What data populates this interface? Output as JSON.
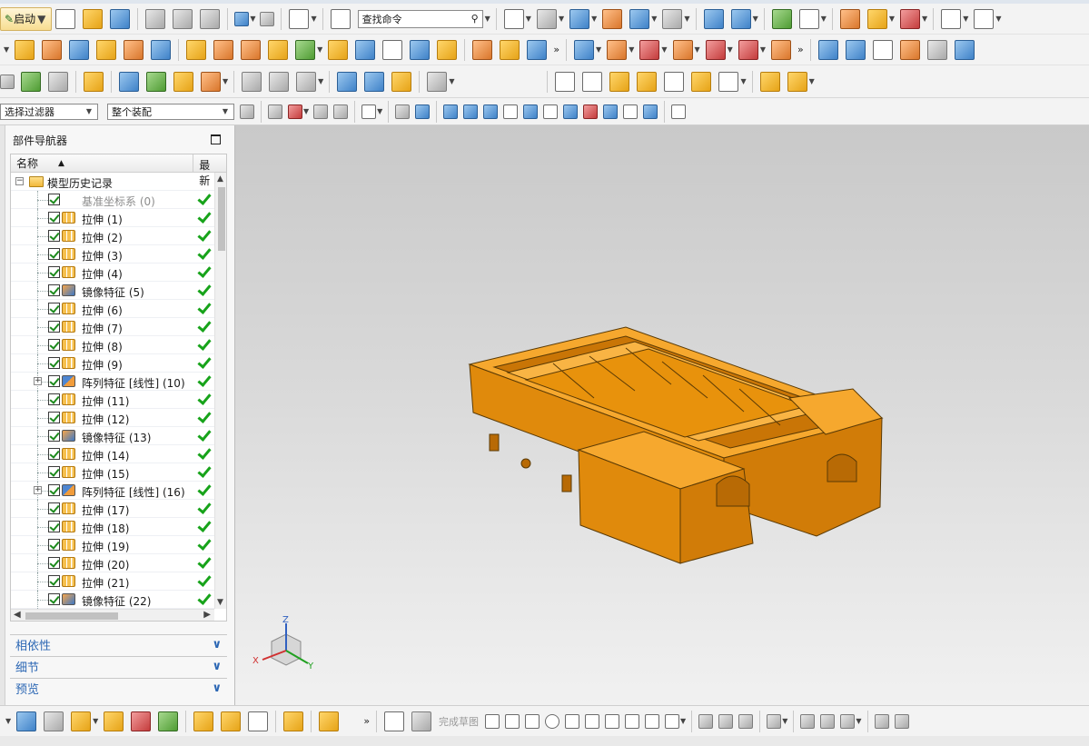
{
  "toolbar": {
    "start_label": "启动",
    "command_search_placeholder": "查找命令",
    "selection_filter": "选择过滤器",
    "selection_scope": "整个装配"
  },
  "navigator": {
    "title": "部件导航器",
    "col_name": "名称",
    "col_latest": "最新",
    "root_label": "模型历史记录",
    "features": [
      {
        "label": "基准坐标系 (0)",
        "type": "datum",
        "expand": false,
        "dim": true
      },
      {
        "label": "拉伸 (1)",
        "type": "ext",
        "expand": false
      },
      {
        "label": "拉伸 (2)",
        "type": "ext",
        "expand": false
      },
      {
        "label": "拉伸 (3)",
        "type": "ext",
        "expand": false
      },
      {
        "label": "拉伸 (4)",
        "type": "ext",
        "expand": false
      },
      {
        "label": "镜像特征 (5)",
        "type": "mir",
        "expand": false
      },
      {
        "label": "拉伸 (6)",
        "type": "ext",
        "expand": false
      },
      {
        "label": "拉伸 (7)",
        "type": "ext",
        "expand": false
      },
      {
        "label": "拉伸 (8)",
        "type": "ext",
        "expand": false
      },
      {
        "label": "拉伸 (9)",
        "type": "ext",
        "expand": false
      },
      {
        "label": "阵列特征 [线性] (10)",
        "type": "pat",
        "expand": true
      },
      {
        "label": "拉伸 (11)",
        "type": "ext",
        "expand": false
      },
      {
        "label": "拉伸 (12)",
        "type": "ext",
        "expand": false
      },
      {
        "label": "镜像特征 (13)",
        "type": "mir",
        "expand": false
      },
      {
        "label": "拉伸 (14)",
        "type": "ext",
        "expand": false
      },
      {
        "label": "拉伸 (15)",
        "type": "ext",
        "expand": false
      },
      {
        "label": "阵列特征 [线性] (16)",
        "type": "pat",
        "expand": true
      },
      {
        "label": "拉伸 (17)",
        "type": "ext",
        "expand": false
      },
      {
        "label": "拉伸 (18)",
        "type": "ext",
        "expand": false
      },
      {
        "label": "拉伸 (19)",
        "type": "ext",
        "expand": false
      },
      {
        "label": "拉伸 (20)",
        "type": "ext",
        "expand": false
      },
      {
        "label": "拉伸 (21)",
        "type": "ext",
        "expand": false
      },
      {
        "label": "镜像特征 (22)",
        "type": "mir",
        "expand": false
      }
    ],
    "panels": [
      "相依性",
      "细节",
      "预览"
    ]
  },
  "viewport": {
    "triad": {
      "x": "X",
      "y": "Y",
      "z": "Z"
    },
    "model_color": "#e8920c"
  },
  "bottom_toolbar": {
    "finish_sketch_label": "完成草图"
  },
  "colors": {
    "accent": "#2c67b4",
    "check": "#17a31a"
  }
}
